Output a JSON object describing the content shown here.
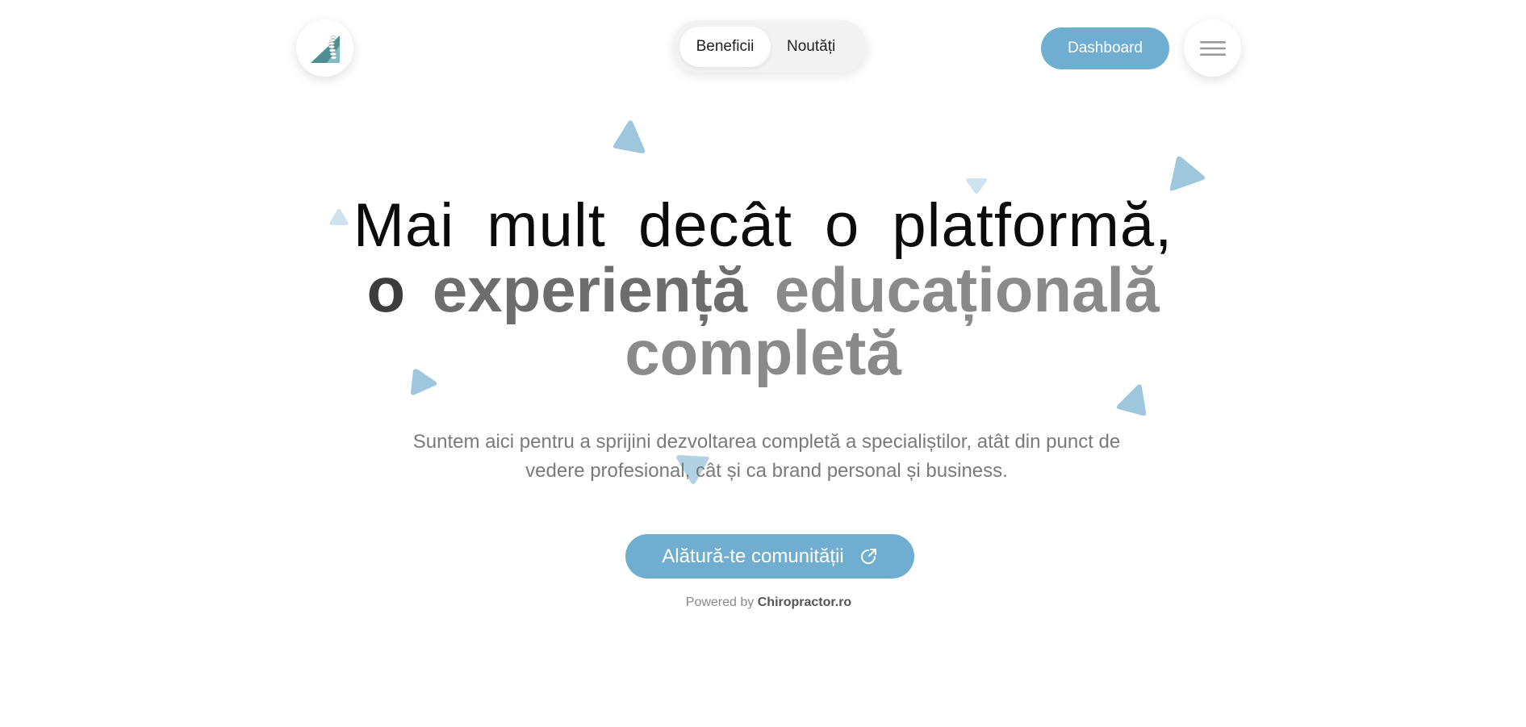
{
  "header": {
    "logo_alt": "spine-logo",
    "nav": {
      "tabs": [
        {
          "label": "Beneficii",
          "active": true
        },
        {
          "label": "Noutăți",
          "active": false
        }
      ]
    },
    "dashboard_label": "Dashboard",
    "menu_icon": "hamburger-icon"
  },
  "hero": {
    "line1": "Mai mult decât o platformă,",
    "line2_word1": "o",
    "line2_word2": "experiență",
    "line2_word3": "educațională",
    "line3": "completă",
    "subtitle": "Suntem aici pentru a sprijini dezvoltarea completă a specialiștilor, atât din punct de vedere profesional, cât și ca brand personal și business."
  },
  "cta": {
    "label": "Alătură-te comunității",
    "icon": "external-link-icon"
  },
  "footer": {
    "powered_prefix": "Powered by",
    "powered_brand": "Chiropractor.ro"
  },
  "colors": {
    "accent": "#6faed0",
    "triangle_light": "#cfe3ee",
    "triangle_mid": "#9ec7de"
  }
}
